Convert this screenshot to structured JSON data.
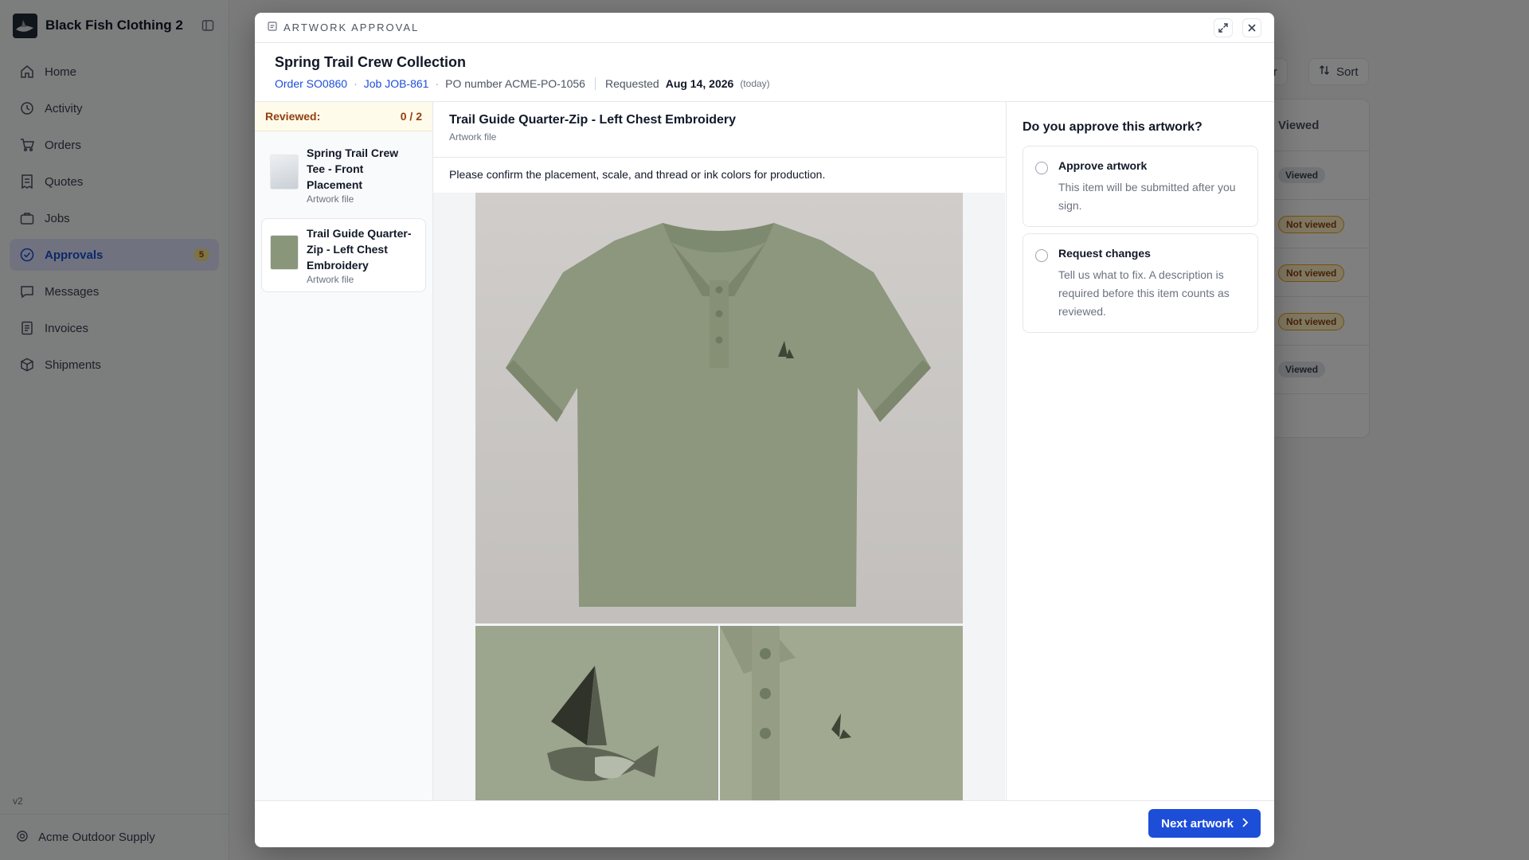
{
  "app": {
    "name": "Black Fish Clothing 2",
    "version": "v2",
    "org": "Acme Outdoor Supply"
  },
  "sidebar": {
    "items": [
      {
        "label": "Home",
        "icon": "home-icon"
      },
      {
        "label": "Activity",
        "icon": "history-icon"
      },
      {
        "label": "Orders",
        "icon": "cart-icon"
      },
      {
        "label": "Quotes",
        "icon": "receipt-icon"
      },
      {
        "label": "Jobs",
        "icon": "briefcase-icon"
      },
      {
        "label": "Approvals",
        "icon": "check-circle-icon",
        "badge": "5",
        "active": true
      },
      {
        "label": "Messages",
        "icon": "message-icon"
      },
      {
        "label": "Invoices",
        "icon": "invoice-icon"
      },
      {
        "label": "Shipments",
        "icon": "package-icon"
      }
    ]
  },
  "background": {
    "filter_label": "lter",
    "sort_label": "Sort",
    "column_header": "Viewed",
    "statuses": [
      "Viewed",
      "Not viewed",
      "Not viewed",
      "Not viewed",
      "Viewed"
    ]
  },
  "modal": {
    "kicker": "ARTWORK APPROVAL",
    "title": "Spring Trail Crew Collection",
    "order": "Order SO0860",
    "job": "Job JOB-861",
    "po": "PO number ACME-PO-1056",
    "requested_label": "Requested",
    "requested_date": "Aug 14, 2026",
    "requested_note": "(today)",
    "reviewed_label": "Reviewed:",
    "reviewed_count": "0 / 2",
    "artworks": [
      {
        "title": "Spring Trail Crew Tee - Front Placement",
        "sub": "Artwork file"
      },
      {
        "title": "Trail Guide Quarter-Zip - Left Chest Embroidery",
        "sub": "Artwork file"
      }
    ],
    "current": {
      "title": "Trail Guide Quarter-Zip - Left Chest Embroidery",
      "sub": "Artwork file",
      "instructions": "Please confirm the placement, scale, and thread or ink colors for production."
    },
    "question": "Do you approve this artwork?",
    "choices": [
      {
        "title": "Approve artwork",
        "desc": "This item will be submitted after you sign."
      },
      {
        "title": "Request changes",
        "desc": "Tell us what to fix. A description is required before this item counts as reviewed."
      }
    ],
    "next_label": "Next artwork"
  },
  "colors": {
    "accent": "#1d4ed8",
    "garment": "#8c977d"
  }
}
